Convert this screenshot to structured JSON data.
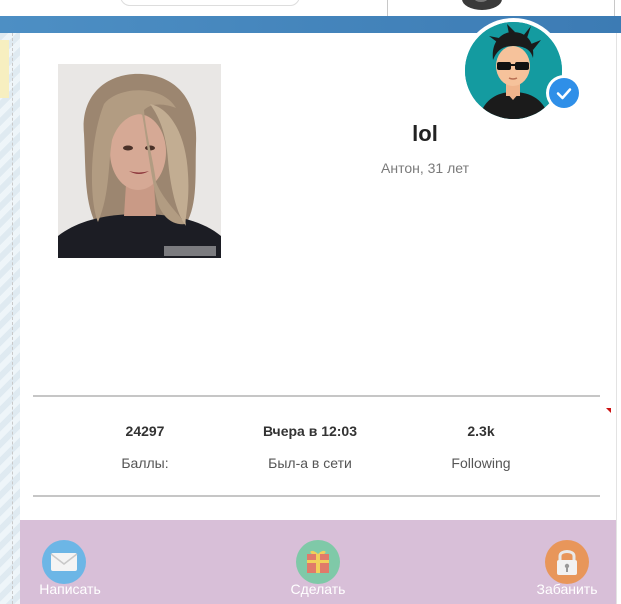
{
  "profile": {
    "name": "lol",
    "subtitle": "Антон, 31 лет"
  },
  "stats": [
    {
      "value": "24297",
      "label": "Баллы:"
    },
    {
      "value": "Вчера в 12:03",
      "label": "Был-а в сети"
    },
    {
      "value": "2.3k",
      "label": "Following"
    }
  ],
  "actions": [
    {
      "label": "Написать",
      "icon": "envelope-icon",
      "color": "#6cb6e6"
    },
    {
      "label": "Сделать",
      "icon": "gift-icon",
      "color": "#7fc9a8"
    },
    {
      "label": "Забанить",
      "icon": "lock-icon",
      "color": "#e8965a"
    }
  ],
  "colors": {
    "header": "#4d8fc4",
    "action_bar": "#d8bfd8",
    "verified": "#2f8fe8",
    "avatar_bg": "#149ba0"
  }
}
